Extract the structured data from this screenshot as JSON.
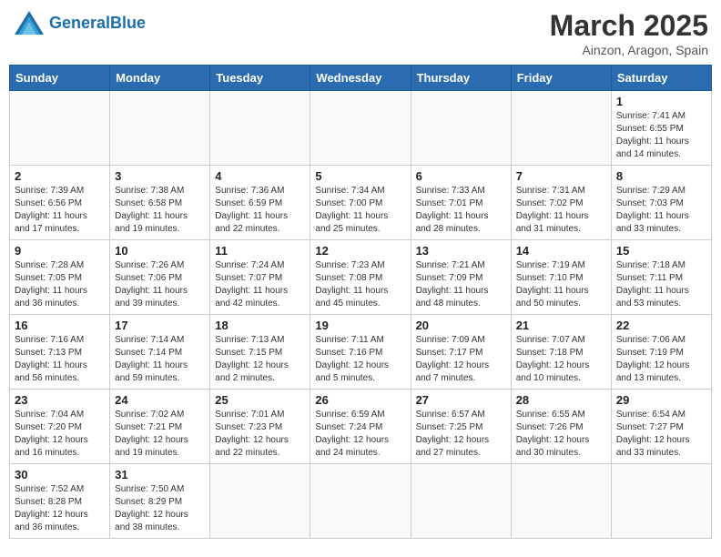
{
  "header": {
    "logo_general": "General",
    "logo_blue": "Blue",
    "month": "March 2025",
    "location": "Ainzon, Aragon, Spain"
  },
  "weekdays": [
    "Sunday",
    "Monday",
    "Tuesday",
    "Wednesday",
    "Thursday",
    "Friday",
    "Saturday"
  ],
  "weeks": [
    [
      {
        "day": "",
        "info": ""
      },
      {
        "day": "",
        "info": ""
      },
      {
        "day": "",
        "info": ""
      },
      {
        "day": "",
        "info": ""
      },
      {
        "day": "",
        "info": ""
      },
      {
        "day": "",
        "info": ""
      },
      {
        "day": "1",
        "info": "Sunrise: 7:41 AM\nSunset: 6:55 PM\nDaylight: 11 hours\nand 14 minutes."
      }
    ],
    [
      {
        "day": "2",
        "info": "Sunrise: 7:39 AM\nSunset: 6:56 PM\nDaylight: 11 hours\nand 17 minutes."
      },
      {
        "day": "3",
        "info": "Sunrise: 7:38 AM\nSunset: 6:58 PM\nDaylight: 11 hours\nand 19 minutes."
      },
      {
        "day": "4",
        "info": "Sunrise: 7:36 AM\nSunset: 6:59 PM\nDaylight: 11 hours\nand 22 minutes."
      },
      {
        "day": "5",
        "info": "Sunrise: 7:34 AM\nSunset: 7:00 PM\nDaylight: 11 hours\nand 25 minutes."
      },
      {
        "day": "6",
        "info": "Sunrise: 7:33 AM\nSunset: 7:01 PM\nDaylight: 11 hours\nand 28 minutes."
      },
      {
        "day": "7",
        "info": "Sunrise: 7:31 AM\nSunset: 7:02 PM\nDaylight: 11 hours\nand 31 minutes."
      },
      {
        "day": "8",
        "info": "Sunrise: 7:29 AM\nSunset: 7:03 PM\nDaylight: 11 hours\nand 33 minutes."
      }
    ],
    [
      {
        "day": "9",
        "info": "Sunrise: 7:28 AM\nSunset: 7:05 PM\nDaylight: 11 hours\nand 36 minutes."
      },
      {
        "day": "10",
        "info": "Sunrise: 7:26 AM\nSunset: 7:06 PM\nDaylight: 11 hours\nand 39 minutes."
      },
      {
        "day": "11",
        "info": "Sunrise: 7:24 AM\nSunset: 7:07 PM\nDaylight: 11 hours\nand 42 minutes."
      },
      {
        "day": "12",
        "info": "Sunrise: 7:23 AM\nSunset: 7:08 PM\nDaylight: 11 hours\nand 45 minutes."
      },
      {
        "day": "13",
        "info": "Sunrise: 7:21 AM\nSunset: 7:09 PM\nDaylight: 11 hours\nand 48 minutes."
      },
      {
        "day": "14",
        "info": "Sunrise: 7:19 AM\nSunset: 7:10 PM\nDaylight: 11 hours\nand 50 minutes."
      },
      {
        "day": "15",
        "info": "Sunrise: 7:18 AM\nSunset: 7:11 PM\nDaylight: 11 hours\nand 53 minutes."
      }
    ],
    [
      {
        "day": "16",
        "info": "Sunrise: 7:16 AM\nSunset: 7:13 PM\nDaylight: 11 hours\nand 56 minutes."
      },
      {
        "day": "17",
        "info": "Sunrise: 7:14 AM\nSunset: 7:14 PM\nDaylight: 11 hours\nand 59 minutes."
      },
      {
        "day": "18",
        "info": "Sunrise: 7:13 AM\nSunset: 7:15 PM\nDaylight: 12 hours\nand 2 minutes."
      },
      {
        "day": "19",
        "info": "Sunrise: 7:11 AM\nSunset: 7:16 PM\nDaylight: 12 hours\nand 5 minutes."
      },
      {
        "day": "20",
        "info": "Sunrise: 7:09 AM\nSunset: 7:17 PM\nDaylight: 12 hours\nand 7 minutes."
      },
      {
        "day": "21",
        "info": "Sunrise: 7:07 AM\nSunset: 7:18 PM\nDaylight: 12 hours\nand 10 minutes."
      },
      {
        "day": "22",
        "info": "Sunrise: 7:06 AM\nSunset: 7:19 PM\nDaylight: 12 hours\nand 13 minutes."
      }
    ],
    [
      {
        "day": "23",
        "info": "Sunrise: 7:04 AM\nSunset: 7:20 PM\nDaylight: 12 hours\nand 16 minutes."
      },
      {
        "day": "24",
        "info": "Sunrise: 7:02 AM\nSunset: 7:21 PM\nDaylight: 12 hours\nand 19 minutes."
      },
      {
        "day": "25",
        "info": "Sunrise: 7:01 AM\nSunset: 7:23 PM\nDaylight: 12 hours\nand 22 minutes."
      },
      {
        "day": "26",
        "info": "Sunrise: 6:59 AM\nSunset: 7:24 PM\nDaylight: 12 hours\nand 24 minutes."
      },
      {
        "day": "27",
        "info": "Sunrise: 6:57 AM\nSunset: 7:25 PM\nDaylight: 12 hours\nand 27 minutes."
      },
      {
        "day": "28",
        "info": "Sunrise: 6:55 AM\nSunset: 7:26 PM\nDaylight: 12 hours\nand 30 minutes."
      },
      {
        "day": "29",
        "info": "Sunrise: 6:54 AM\nSunset: 7:27 PM\nDaylight: 12 hours\nand 33 minutes."
      }
    ],
    [
      {
        "day": "30",
        "info": "Sunrise: 7:52 AM\nSunset: 8:28 PM\nDaylight: 12 hours\nand 36 minutes."
      },
      {
        "day": "31",
        "info": "Sunrise: 7:50 AM\nSunset: 8:29 PM\nDaylight: 12 hours\nand 38 minutes."
      },
      {
        "day": "",
        "info": ""
      },
      {
        "day": "",
        "info": ""
      },
      {
        "day": "",
        "info": ""
      },
      {
        "day": "",
        "info": ""
      },
      {
        "day": "",
        "info": ""
      }
    ]
  ]
}
